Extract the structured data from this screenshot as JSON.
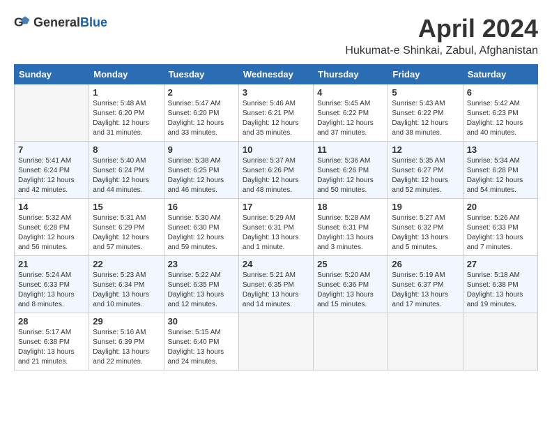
{
  "header": {
    "logo_general": "General",
    "logo_blue": "Blue",
    "title": "April 2024",
    "subtitle": "Hukumat-e Shinkai, Zabul, Afghanistan"
  },
  "weekdays": [
    "Sunday",
    "Monday",
    "Tuesday",
    "Wednesday",
    "Thursday",
    "Friday",
    "Saturday"
  ],
  "weeks": [
    [
      {
        "day": "",
        "info": ""
      },
      {
        "day": "1",
        "info": "Sunrise: 5:48 AM\nSunset: 6:20 PM\nDaylight: 12 hours\nand 31 minutes."
      },
      {
        "day": "2",
        "info": "Sunrise: 5:47 AM\nSunset: 6:20 PM\nDaylight: 12 hours\nand 33 minutes."
      },
      {
        "day": "3",
        "info": "Sunrise: 5:46 AM\nSunset: 6:21 PM\nDaylight: 12 hours\nand 35 minutes."
      },
      {
        "day": "4",
        "info": "Sunrise: 5:45 AM\nSunset: 6:22 PM\nDaylight: 12 hours\nand 37 minutes."
      },
      {
        "day": "5",
        "info": "Sunrise: 5:43 AM\nSunset: 6:22 PM\nDaylight: 12 hours\nand 38 minutes."
      },
      {
        "day": "6",
        "info": "Sunrise: 5:42 AM\nSunset: 6:23 PM\nDaylight: 12 hours\nand 40 minutes."
      }
    ],
    [
      {
        "day": "7",
        "info": "Sunrise: 5:41 AM\nSunset: 6:24 PM\nDaylight: 12 hours\nand 42 minutes."
      },
      {
        "day": "8",
        "info": "Sunrise: 5:40 AM\nSunset: 6:24 PM\nDaylight: 12 hours\nand 44 minutes."
      },
      {
        "day": "9",
        "info": "Sunrise: 5:38 AM\nSunset: 6:25 PM\nDaylight: 12 hours\nand 46 minutes."
      },
      {
        "day": "10",
        "info": "Sunrise: 5:37 AM\nSunset: 6:26 PM\nDaylight: 12 hours\nand 48 minutes."
      },
      {
        "day": "11",
        "info": "Sunrise: 5:36 AM\nSunset: 6:26 PM\nDaylight: 12 hours\nand 50 minutes."
      },
      {
        "day": "12",
        "info": "Sunrise: 5:35 AM\nSunset: 6:27 PM\nDaylight: 12 hours\nand 52 minutes."
      },
      {
        "day": "13",
        "info": "Sunrise: 5:34 AM\nSunset: 6:28 PM\nDaylight: 12 hours\nand 54 minutes."
      }
    ],
    [
      {
        "day": "14",
        "info": "Sunrise: 5:32 AM\nSunset: 6:28 PM\nDaylight: 12 hours\nand 56 minutes."
      },
      {
        "day": "15",
        "info": "Sunrise: 5:31 AM\nSunset: 6:29 PM\nDaylight: 12 hours\nand 57 minutes."
      },
      {
        "day": "16",
        "info": "Sunrise: 5:30 AM\nSunset: 6:30 PM\nDaylight: 12 hours\nand 59 minutes."
      },
      {
        "day": "17",
        "info": "Sunrise: 5:29 AM\nSunset: 6:31 PM\nDaylight: 13 hours\nand 1 minute."
      },
      {
        "day": "18",
        "info": "Sunrise: 5:28 AM\nSunset: 6:31 PM\nDaylight: 13 hours\nand 3 minutes."
      },
      {
        "day": "19",
        "info": "Sunrise: 5:27 AM\nSunset: 6:32 PM\nDaylight: 13 hours\nand 5 minutes."
      },
      {
        "day": "20",
        "info": "Sunrise: 5:26 AM\nSunset: 6:33 PM\nDaylight: 13 hours\nand 7 minutes."
      }
    ],
    [
      {
        "day": "21",
        "info": "Sunrise: 5:24 AM\nSunset: 6:33 PM\nDaylight: 13 hours\nand 8 minutes."
      },
      {
        "day": "22",
        "info": "Sunrise: 5:23 AM\nSunset: 6:34 PM\nDaylight: 13 hours\nand 10 minutes."
      },
      {
        "day": "23",
        "info": "Sunrise: 5:22 AM\nSunset: 6:35 PM\nDaylight: 13 hours\nand 12 minutes."
      },
      {
        "day": "24",
        "info": "Sunrise: 5:21 AM\nSunset: 6:35 PM\nDaylight: 13 hours\nand 14 minutes."
      },
      {
        "day": "25",
        "info": "Sunrise: 5:20 AM\nSunset: 6:36 PM\nDaylight: 13 hours\nand 15 minutes."
      },
      {
        "day": "26",
        "info": "Sunrise: 5:19 AM\nSunset: 6:37 PM\nDaylight: 13 hours\nand 17 minutes."
      },
      {
        "day": "27",
        "info": "Sunrise: 5:18 AM\nSunset: 6:38 PM\nDaylight: 13 hours\nand 19 minutes."
      }
    ],
    [
      {
        "day": "28",
        "info": "Sunrise: 5:17 AM\nSunset: 6:38 PM\nDaylight: 13 hours\nand 21 minutes."
      },
      {
        "day": "29",
        "info": "Sunrise: 5:16 AM\nSunset: 6:39 PM\nDaylight: 13 hours\nand 22 minutes."
      },
      {
        "day": "30",
        "info": "Sunrise: 5:15 AM\nSunset: 6:40 PM\nDaylight: 13 hours\nand 24 minutes."
      },
      {
        "day": "",
        "info": ""
      },
      {
        "day": "",
        "info": ""
      },
      {
        "day": "",
        "info": ""
      },
      {
        "day": "",
        "info": ""
      }
    ]
  ]
}
